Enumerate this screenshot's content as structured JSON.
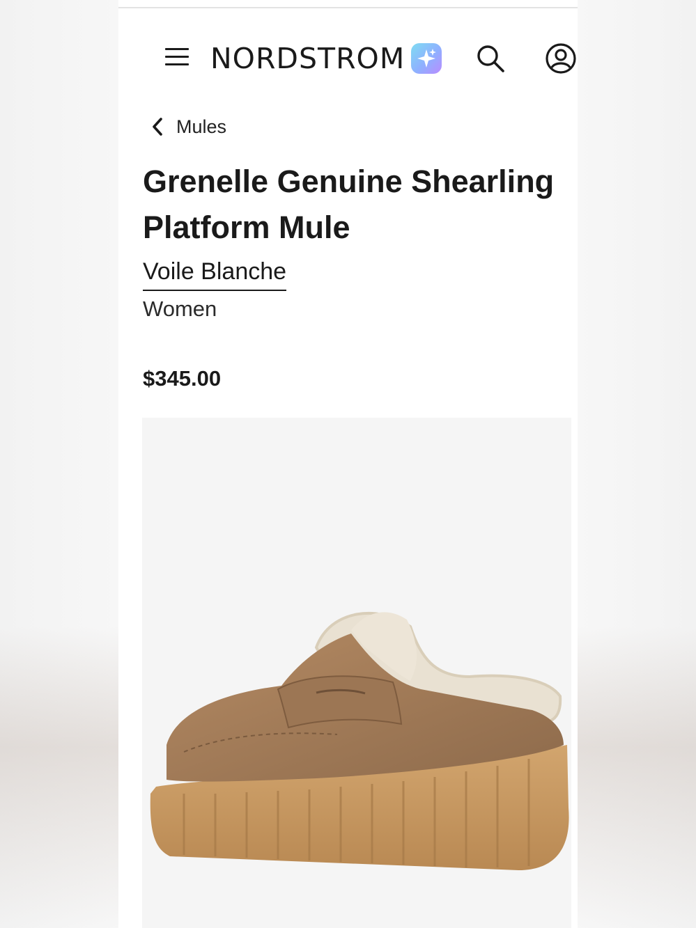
{
  "header": {
    "logo_text": "NORDSTROM",
    "menu_icon": "hamburger-menu-icon",
    "ai_icon": "sparkle-assistant-icon",
    "search_icon": "search-icon",
    "account_icon": "account-icon"
  },
  "breadcrumb": {
    "label": "Mules",
    "icon": "chevron-left-icon"
  },
  "product": {
    "title": "Grenelle Genuine Shearling Platform Mule",
    "brand": "Voile Blanche",
    "gender": "Women",
    "price": "$345.00",
    "image_subject": "tan suede shearling platform mule"
  },
  "colors": {
    "ai_gradient_start": "#7fdcf2",
    "ai_gradient_end": "#b98cff",
    "suede": "#a57e5a",
    "sole": "#c99a63",
    "shearling": "#ece4d6"
  }
}
